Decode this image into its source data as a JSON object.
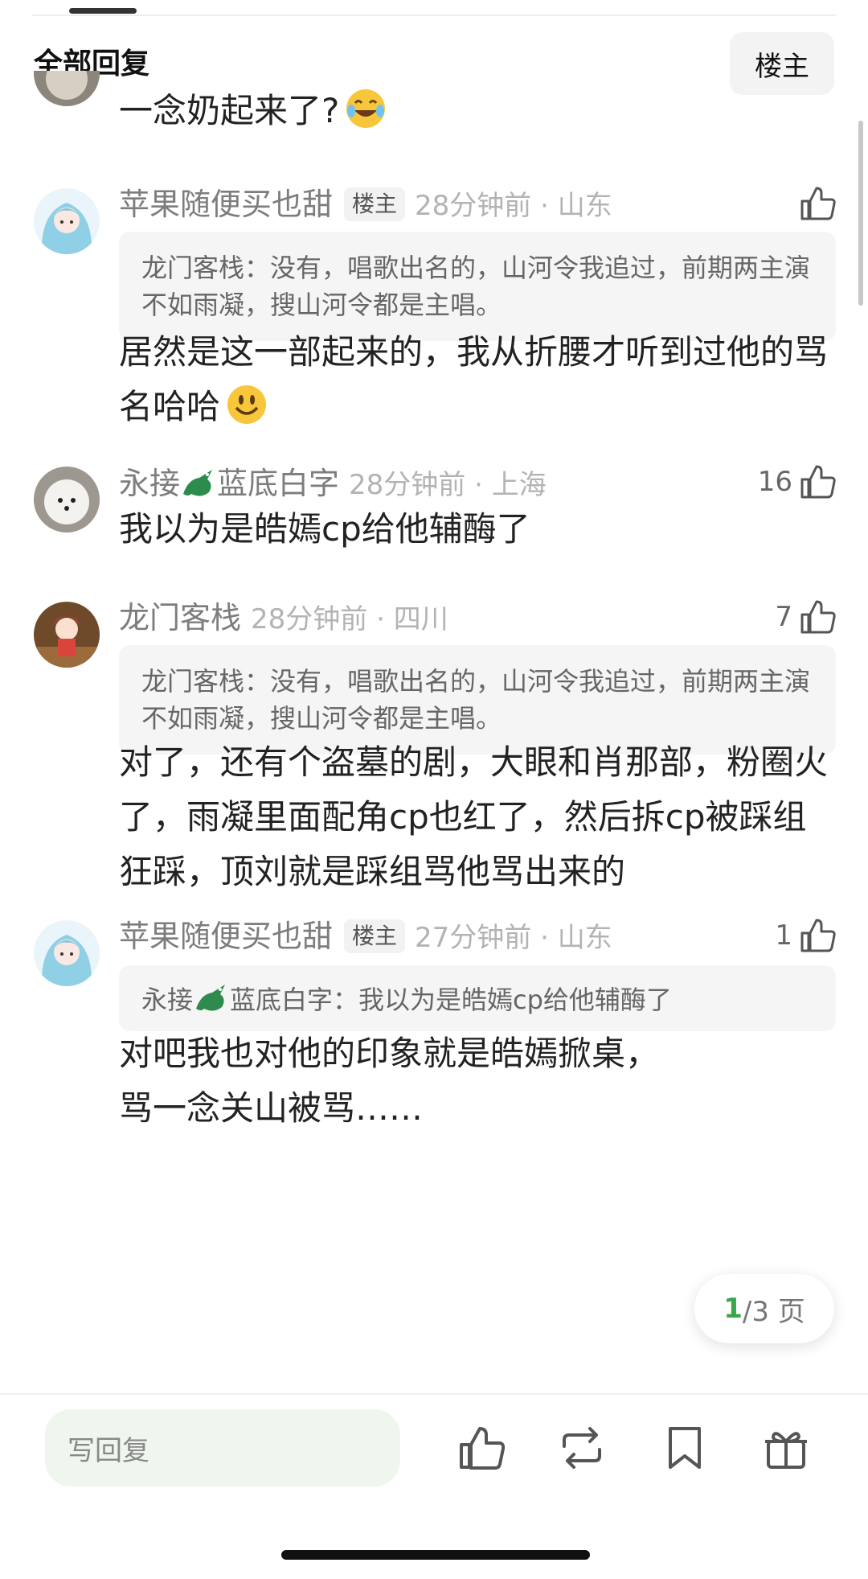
{
  "header": {
    "title": "全部回复",
    "op_button": "楼主"
  },
  "comments": [
    {
      "text": "一念奶起来了?"
    },
    {
      "name": "苹果随便买也甜",
      "tag": "楼主",
      "meta": "28分钟前 · 山东",
      "likes": "",
      "quote": "龙门客栈：没有，唱歌出名的，山河令我追过，前期两主演不如雨凝，搜山河令都是主唱。",
      "text": "居然是这一部起来的，我从折腰才听到过他的骂名哈哈"
    },
    {
      "name_a": "永接",
      "name_b": "蓝底白字",
      "meta": "28分钟前 · 上海",
      "likes": "16",
      "text": "我以为是皓嫣cp给他辅酶了"
    },
    {
      "name": "龙门客栈",
      "meta": "28分钟前 · 四川",
      "likes": "7",
      "quote": "龙门客栈：没有，唱歌出名的，山河令我追过，前期两主演不如雨凝，搜山河令都是主唱。",
      "text": "对了，还有个盗墓的剧，大眼和肖那部，粉圈火了，雨凝里面配角cp也红了，然后拆cp被踩组狂踩，顶刘就是踩组骂他骂出来的"
    },
    {
      "name": "苹果随便买也甜",
      "tag": "楼主",
      "meta": "27分钟前 · 山东",
      "likes": "1",
      "quote_a": "永接",
      "quote_b": "蓝底白字：我以为是皓嫣cp给他辅酶了",
      "text_line1": "对吧我也对他的印象就是皓嫣掀桌，",
      "text_line2": "骂一念关山被骂……"
    }
  ],
  "pager": {
    "current": "1",
    "rest": "/3 页"
  },
  "bottom_bar": {
    "reply_placeholder": "写回复"
  },
  "colors": {
    "accent_green": "#3aa64b",
    "reply_bg": "#eef6ee"
  }
}
